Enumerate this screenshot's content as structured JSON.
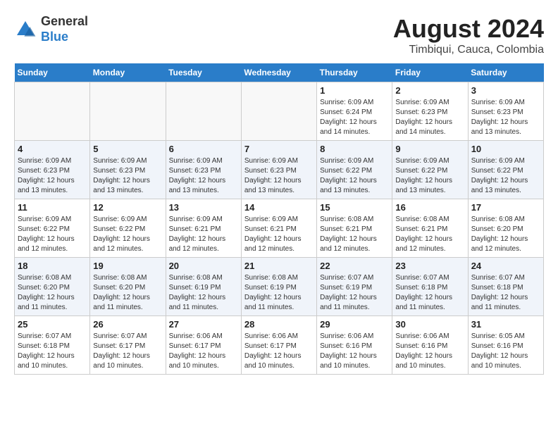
{
  "header": {
    "logo_line1": "General",
    "logo_line2": "Blue",
    "month_year": "August 2024",
    "location": "Timbiqui, Cauca, Colombia"
  },
  "days_of_week": [
    "Sunday",
    "Monday",
    "Tuesday",
    "Wednesday",
    "Thursday",
    "Friday",
    "Saturday"
  ],
  "weeks": [
    [
      {
        "day": "",
        "info": ""
      },
      {
        "day": "",
        "info": ""
      },
      {
        "day": "",
        "info": ""
      },
      {
        "day": "",
        "info": ""
      },
      {
        "day": "1",
        "info": "Sunrise: 6:09 AM\nSunset: 6:24 PM\nDaylight: 12 hours\nand 14 minutes."
      },
      {
        "day": "2",
        "info": "Sunrise: 6:09 AM\nSunset: 6:23 PM\nDaylight: 12 hours\nand 14 minutes."
      },
      {
        "day": "3",
        "info": "Sunrise: 6:09 AM\nSunset: 6:23 PM\nDaylight: 12 hours\nand 13 minutes."
      }
    ],
    [
      {
        "day": "4",
        "info": "Sunrise: 6:09 AM\nSunset: 6:23 PM\nDaylight: 12 hours\nand 13 minutes."
      },
      {
        "day": "5",
        "info": "Sunrise: 6:09 AM\nSunset: 6:23 PM\nDaylight: 12 hours\nand 13 minutes."
      },
      {
        "day": "6",
        "info": "Sunrise: 6:09 AM\nSunset: 6:23 PM\nDaylight: 12 hours\nand 13 minutes."
      },
      {
        "day": "7",
        "info": "Sunrise: 6:09 AM\nSunset: 6:23 PM\nDaylight: 12 hours\nand 13 minutes."
      },
      {
        "day": "8",
        "info": "Sunrise: 6:09 AM\nSunset: 6:22 PM\nDaylight: 12 hours\nand 13 minutes."
      },
      {
        "day": "9",
        "info": "Sunrise: 6:09 AM\nSunset: 6:22 PM\nDaylight: 12 hours\nand 13 minutes."
      },
      {
        "day": "10",
        "info": "Sunrise: 6:09 AM\nSunset: 6:22 PM\nDaylight: 12 hours\nand 13 minutes."
      }
    ],
    [
      {
        "day": "11",
        "info": "Sunrise: 6:09 AM\nSunset: 6:22 PM\nDaylight: 12 hours\nand 12 minutes."
      },
      {
        "day": "12",
        "info": "Sunrise: 6:09 AM\nSunset: 6:22 PM\nDaylight: 12 hours\nand 12 minutes."
      },
      {
        "day": "13",
        "info": "Sunrise: 6:09 AM\nSunset: 6:21 PM\nDaylight: 12 hours\nand 12 minutes."
      },
      {
        "day": "14",
        "info": "Sunrise: 6:09 AM\nSunset: 6:21 PM\nDaylight: 12 hours\nand 12 minutes."
      },
      {
        "day": "15",
        "info": "Sunrise: 6:08 AM\nSunset: 6:21 PM\nDaylight: 12 hours\nand 12 minutes."
      },
      {
        "day": "16",
        "info": "Sunrise: 6:08 AM\nSunset: 6:21 PM\nDaylight: 12 hours\nand 12 minutes."
      },
      {
        "day": "17",
        "info": "Sunrise: 6:08 AM\nSunset: 6:20 PM\nDaylight: 12 hours\nand 12 minutes."
      }
    ],
    [
      {
        "day": "18",
        "info": "Sunrise: 6:08 AM\nSunset: 6:20 PM\nDaylight: 12 hours\nand 11 minutes."
      },
      {
        "day": "19",
        "info": "Sunrise: 6:08 AM\nSunset: 6:20 PM\nDaylight: 12 hours\nand 11 minutes."
      },
      {
        "day": "20",
        "info": "Sunrise: 6:08 AM\nSunset: 6:19 PM\nDaylight: 12 hours\nand 11 minutes."
      },
      {
        "day": "21",
        "info": "Sunrise: 6:08 AM\nSunset: 6:19 PM\nDaylight: 12 hours\nand 11 minutes."
      },
      {
        "day": "22",
        "info": "Sunrise: 6:07 AM\nSunset: 6:19 PM\nDaylight: 12 hours\nand 11 minutes."
      },
      {
        "day": "23",
        "info": "Sunrise: 6:07 AM\nSunset: 6:18 PM\nDaylight: 12 hours\nand 11 minutes."
      },
      {
        "day": "24",
        "info": "Sunrise: 6:07 AM\nSunset: 6:18 PM\nDaylight: 12 hours\nand 11 minutes."
      }
    ],
    [
      {
        "day": "25",
        "info": "Sunrise: 6:07 AM\nSunset: 6:18 PM\nDaylight: 12 hours\nand 10 minutes."
      },
      {
        "day": "26",
        "info": "Sunrise: 6:07 AM\nSunset: 6:17 PM\nDaylight: 12 hours\nand 10 minutes."
      },
      {
        "day": "27",
        "info": "Sunrise: 6:06 AM\nSunset: 6:17 PM\nDaylight: 12 hours\nand 10 minutes."
      },
      {
        "day": "28",
        "info": "Sunrise: 6:06 AM\nSunset: 6:17 PM\nDaylight: 12 hours\nand 10 minutes."
      },
      {
        "day": "29",
        "info": "Sunrise: 6:06 AM\nSunset: 6:16 PM\nDaylight: 12 hours\nand 10 minutes."
      },
      {
        "day": "30",
        "info": "Sunrise: 6:06 AM\nSunset: 6:16 PM\nDaylight: 12 hours\nand 10 minutes."
      },
      {
        "day": "31",
        "info": "Sunrise: 6:05 AM\nSunset: 6:16 PM\nDaylight: 12 hours\nand 10 minutes."
      }
    ]
  ]
}
